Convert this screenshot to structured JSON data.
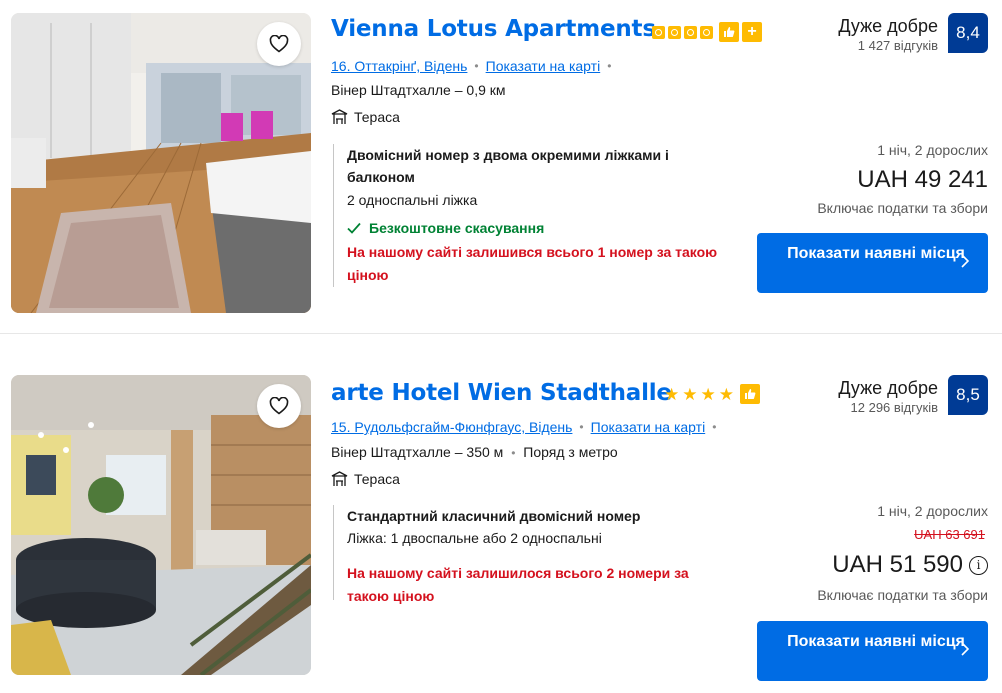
{
  "listings": [
    {
      "name": "Vienna Lotus Apartments",
      "rating_type": "squares",
      "rating_count": 4,
      "address": "16. Оттакрінґ, Відень",
      "map_link": "Показати на карті",
      "distance": "Вінер Штадтхалле – 0,9 км",
      "metro": "",
      "feature": "Тераса",
      "room_name": "Двомісний номер з двома окремими ліжками і балконом",
      "beds": "2 односпальні ліжка",
      "cancellation": "Безкоштовне скасування",
      "scarcity": "На нашому сайті залишився всього 1 номер за такою ціною",
      "score_label": "Дуже добре",
      "reviews": "1 427 відгуків",
      "score": "8,4",
      "nights": "1 ніч, 2 дорослих",
      "old_price": "",
      "price": "UAH 49 241",
      "taxes": "Включає податки та збори",
      "cta": "Показати наявні місця"
    },
    {
      "name": "arte Hotel Wien Stadthalle",
      "rating_type": "stars",
      "rating_count": 4,
      "address": "15. Рудольфсгайм-Фюнфгаус, Відень",
      "map_link": "Показати на карті",
      "distance": "Вінер Штадтхалле – 350 м",
      "metro": "Поряд з метро",
      "feature": "Тераса",
      "room_name": "Стандартний класичний двомісний номер",
      "beds": "Ліжка: 1 двоспальне або 2 односпальні",
      "cancellation": "",
      "scarcity": "На нашому сайті залишилося всього 2 номери за такою ціною",
      "score_label": "Дуже добре",
      "reviews": "12 296 відгуків",
      "score": "8,5",
      "nights": "1 ніч, 2 дорослих",
      "old_price": "UAH 63 691",
      "price": "UAH 51 590",
      "taxes": "Включає податки та збори",
      "cta": "Показати наявні місця"
    }
  ],
  "colors": {
    "link_blue": "#006ce4",
    "score_navy": "#003b95",
    "rating_yellow": "#febb02",
    "success_green": "#008234",
    "alert_red": "#d4111e"
  },
  "icons": [
    "heart-icon",
    "thumbs-up-icon",
    "plus-icon",
    "terrace-icon",
    "checkmark-icon",
    "info-icon",
    "chevron-right-icon"
  ]
}
